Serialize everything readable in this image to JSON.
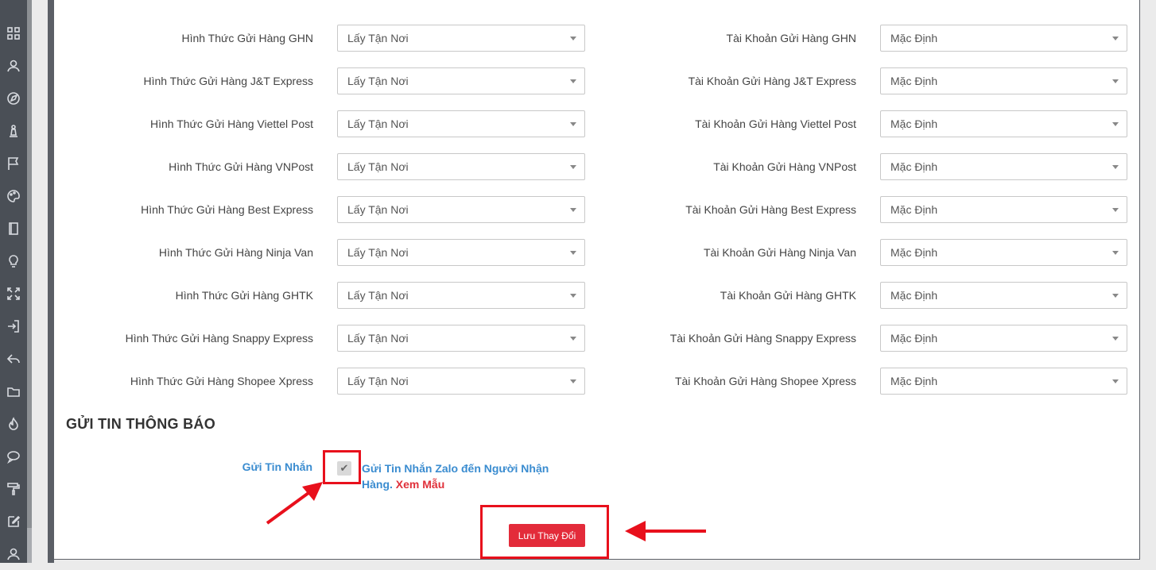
{
  "sidebar": {
    "icons": [
      "grid-icon",
      "user-icon",
      "compass-icon",
      "pawn-icon",
      "flag-icon",
      "palette-icon",
      "book-icon",
      "lightbulb-icon",
      "expand-icon",
      "login-icon",
      "reply-icon",
      "folder-icon",
      "fire-icon",
      "chat-icon",
      "paint-roller-icon",
      "edit-icon",
      "user-icon"
    ]
  },
  "shipping_rows": [
    {
      "method_label": "Hình Thức Gửi Hàng GHN",
      "method_value": "Lấy Tận Nơi",
      "account_label": "Tài Khoản Gửi Hàng GHN",
      "account_value": "Mặc Định"
    },
    {
      "method_label": "Hình Thức Gửi Hàng J&T Express",
      "method_value": "Lấy Tận Nơi",
      "account_label": "Tài Khoản Gửi Hàng J&T Express",
      "account_value": "Mặc Định"
    },
    {
      "method_label": "Hình Thức Gửi Hàng Viettel Post",
      "method_value": "Lấy Tận Nơi",
      "account_label": "Tài Khoản Gửi Hàng Viettel Post",
      "account_value": "Mặc Định"
    },
    {
      "method_label": "Hình Thức Gửi Hàng VNPost",
      "method_value": "Lấy Tận Nơi",
      "account_label": "Tài Khoản Gửi Hàng VNPost",
      "account_value": "Mặc Định"
    },
    {
      "method_label": "Hình Thức Gửi Hàng Best Express",
      "method_value": "Lấy Tận Nơi",
      "account_label": "Tài Khoản Gửi Hàng Best Express",
      "account_value": "Mặc Định"
    },
    {
      "method_label": "Hình Thức Gửi Hàng Ninja Van",
      "method_value": "Lấy Tận Nơi",
      "account_label": "Tài Khoản Gửi Hàng Ninja Van",
      "account_value": "Mặc Định"
    },
    {
      "method_label": "Hình Thức Gửi Hàng GHTK",
      "method_value": "Lấy Tận Nơi",
      "account_label": "Tài Khoản Gửi Hàng GHTK",
      "account_value": "Mặc Định"
    },
    {
      "method_label": "Hình Thức Gửi Hàng Snappy Express",
      "method_value": "Lấy Tận Nơi",
      "account_label": "Tài Khoản Gửi Hàng Snappy Express",
      "account_value": "Mặc Định"
    },
    {
      "method_label": "Hình Thức Gửi Hàng Shopee Xpress",
      "method_value": "Lấy Tận Nơi",
      "account_label": "Tài Khoản Gửi Hàng Shopee Xpress",
      "account_value": "Mặc Định"
    }
  ],
  "notify": {
    "section_title": "GỬI TIN THÔNG BÁO",
    "label": "Gửi Tin Nhắn",
    "checkbox_checked": true,
    "option_text": "Gửi Tin Nhắn Zalo đến Người Nhận Hàng.",
    "sample_link": "Xem Mẫu"
  },
  "actions": {
    "save_label": "Lưu Thay Đổi"
  },
  "colors": {
    "accent_blue": "#3a8cd0",
    "save_red": "#e32b3a",
    "annotation_red": "#e8101c"
  }
}
